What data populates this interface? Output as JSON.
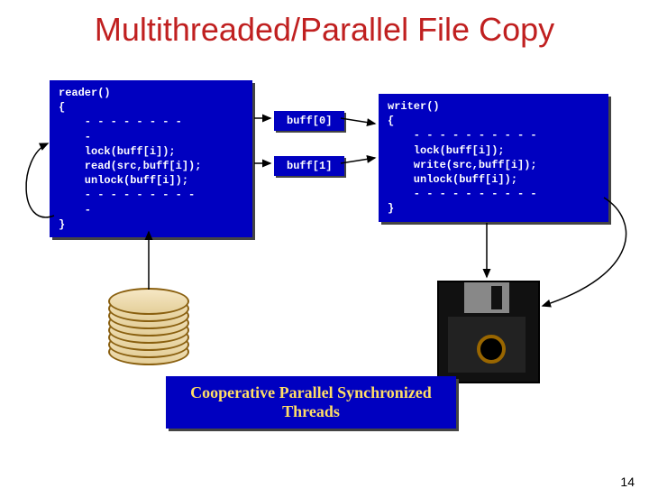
{
  "title": "Multithreaded/Parallel File Copy",
  "reader_code": "reader()\n{\n    - - - - - - - -\n    -\n    lock(buff[i]);\n    read(src,buff[i]);\n    unlock(buff[i]);\n    - - - - - - - - -\n    -\n}",
  "writer_code": "writer()\n{\n    - - - - - - - - - -\n    lock(buff[i]);\n    write(src,buff[i]);\n    unlock(buff[i]);\n    - - - - - - - - - -\n}",
  "buff0": "buff[0]",
  "buff1": "buff[1]",
  "legend": "Cooperative Parallel Synchronized Threads",
  "pagenum": "14"
}
